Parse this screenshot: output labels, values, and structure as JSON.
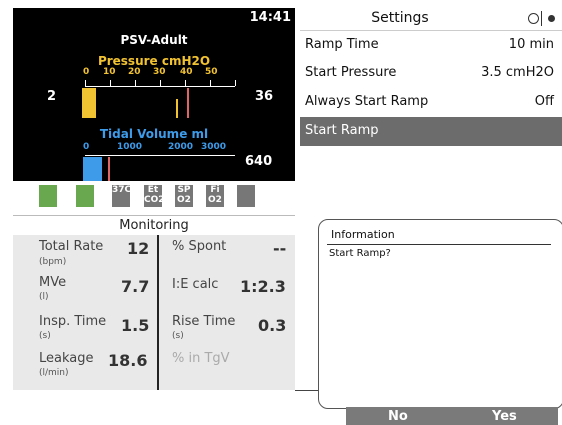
{
  "status_bar": {
    "time": "14:41"
  },
  "graphics": {
    "mode": "PSV-Adult",
    "pressure": {
      "title": "Pressure cmH2O",
      "ticks": [
        "0",
        "10",
        "20",
        "30",
        "40",
        "50"
      ],
      "min_value": "2",
      "max_value": "36",
      "bar_color": "#f1c232",
      "marker_color": "#e06666"
    },
    "tidal_volume": {
      "title": "Tidal Volume ml",
      "ticks": [
        "0",
        "1000",
        "2000",
        "3000"
      ],
      "value": "640",
      "bar_color": "#3d9be9",
      "marker_color": "#e06666"
    }
  },
  "status_icons": [
    {
      "name": "battery-icon",
      "text": ""
    },
    {
      "name": "battery-plug-icon",
      "text": ""
    },
    {
      "name": "humidifier-icon",
      "text": "37C"
    },
    {
      "name": "etco2-icon",
      "text": "Et CO2"
    },
    {
      "name": "spo2-icon",
      "text": "SP O2"
    },
    {
      "name": "fio2-icon",
      "text": "Fi O2"
    },
    {
      "name": "settings-sliders-icon",
      "text": ""
    }
  ],
  "monitoring": {
    "title": "Monitoring",
    "left": [
      {
        "label": "Total Rate",
        "unit": "(bpm)",
        "value": "12"
      },
      {
        "label": "MVe",
        "unit": "(l)",
        "value": "7.7"
      },
      {
        "label": "Insp. Time",
        "unit": "(s)",
        "value": "1.5"
      },
      {
        "label": "Leakage",
        "unit": "(l/min)",
        "value": "18.6"
      }
    ],
    "right": [
      {
        "label": "% Spont",
        "unit": "",
        "value": "--"
      },
      {
        "label": "I:E calc",
        "unit": "",
        "value": "1:2.3"
      },
      {
        "label": "Rise Time",
        "unit": "(s)",
        "value": "0.3"
      },
      {
        "label": "% in TgV",
        "unit": "",
        "value": ""
      }
    ]
  },
  "settings": {
    "title": "Settings",
    "rows": [
      {
        "label": "Ramp Time",
        "value": "10  min"
      },
      {
        "label": "Start Pressure",
        "value": "3.5  cmH2O"
      },
      {
        "label": "Always Start Ramp",
        "value": "Off"
      },
      {
        "label": "Start Ramp",
        "value": ""
      }
    ]
  },
  "dialog": {
    "title": "Information",
    "message": "Start Ramp?",
    "no_label": "No",
    "yes_label": "Yes"
  }
}
